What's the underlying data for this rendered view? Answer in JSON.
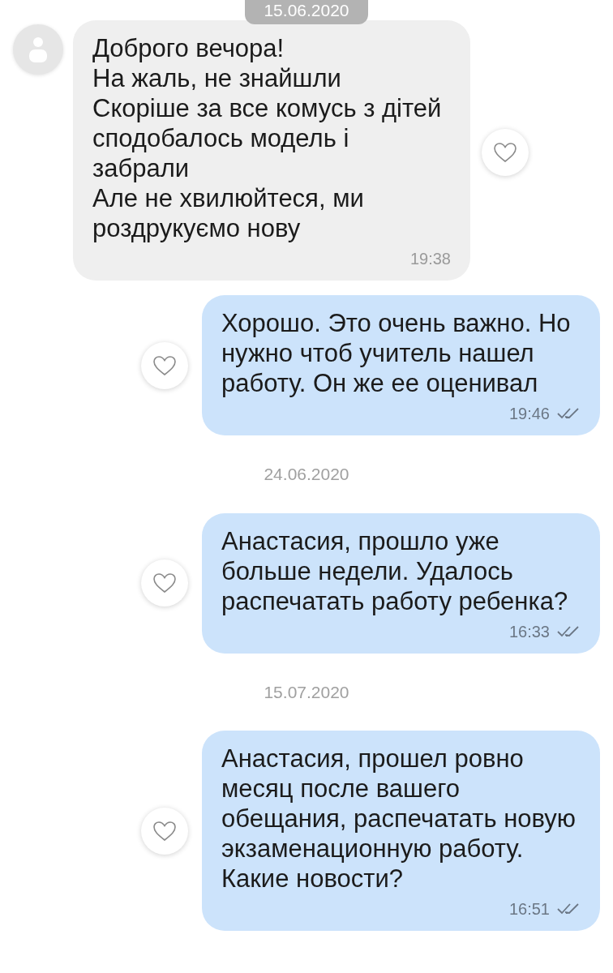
{
  "items": [
    {
      "kind": "sticky_date",
      "text": "15.06.2020"
    },
    {
      "kind": "incoming_message",
      "text": "Доброго вечора!\nНа жаль, не знайшли\nСкоріше за все комусь з дітей сподобалось модель і\nзабрали\nАле не хвилюйтеся, ми роздрукуємо нову",
      "time": "19:38",
      "read": false
    },
    {
      "kind": "outgoing_message",
      "text": "Хорошо. Это очень важно. Но нужно чтоб учитель нашел работу. Он же ее оценивал",
      "time": "19:46",
      "read": true
    },
    {
      "kind": "date",
      "text": "24.06.2020"
    },
    {
      "kind": "outgoing_message",
      "text": "Анастасия, прошло уже больше недели. Удалось распечатать работу ребенка?",
      "time": "16:33",
      "read": true
    },
    {
      "kind": "date",
      "text": "15.07.2020"
    },
    {
      "kind": "outgoing_message",
      "text": "Анастасия, прошел ровно месяц после вашего обещания, распечатать новую экзаменационную работу. Какие новости?",
      "time": "16:51",
      "read": true
    }
  ]
}
